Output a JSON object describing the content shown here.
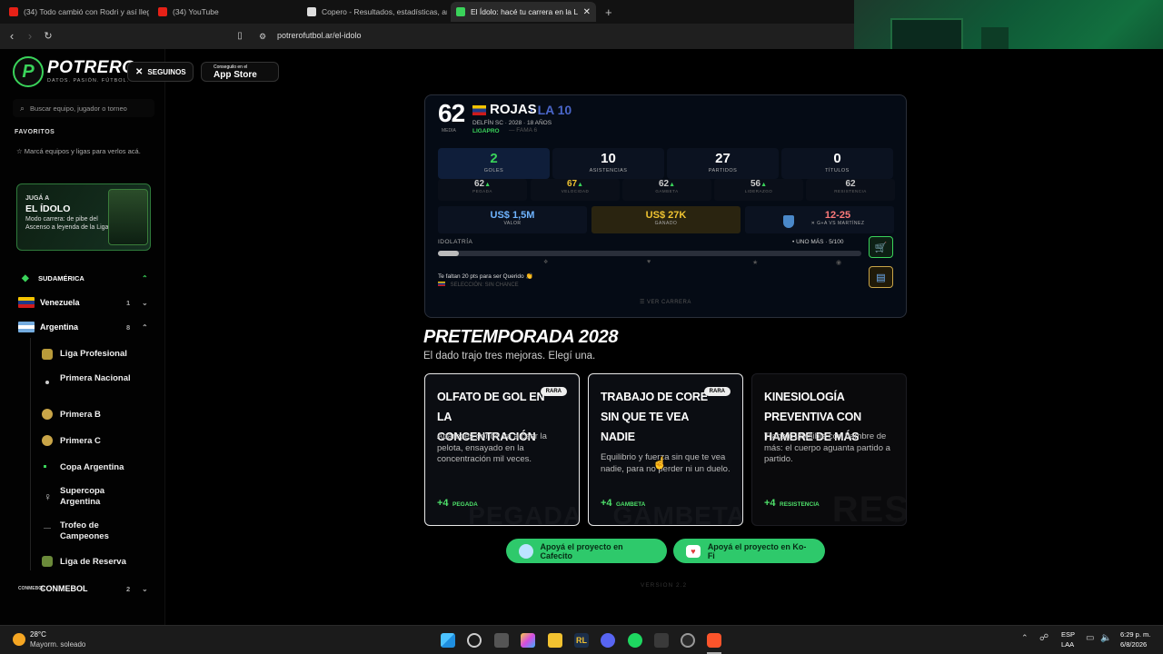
{
  "browser": {
    "tabs": [
      {
        "title": "(34) Todo cambió con Rodri y así lleg",
        "color": "#e62117"
      },
      {
        "title": "(34) YouTube",
        "color": "#e62117"
      },
      {
        "title": "Copero - Resultados, estadísticas, an",
        "color": "#dddddd"
      },
      {
        "title": "El Ídolo: hacé tu carrera en la Lig",
        "color": "#3ad35a"
      }
    ],
    "new_tab": "+",
    "url": "potrerofutbol.ar/el-idolo"
  },
  "sidebar": {
    "logo_text": "POTRERO",
    "logo_sub": "DATOS. PASIÓN. FÚTBOL.",
    "follow_label": "SEGUINOS",
    "appstore_small": "Conseguilo en el",
    "appstore_big": "App Store",
    "search_placeholder": "Buscar equipo, jugador o torneo",
    "favorites_title": "FAVORITOS",
    "favorites_note": "☆  Marcá equipos y ligas para verlos acá.",
    "idolo_promo": {
      "line1": "JUGÁ A",
      "line2": "EL ÍDOLO",
      "line3": "Modo carrera: de pibe del Ascenso a leyenda de la Liga"
    },
    "region": "SUDAMÉRICA",
    "countries": [
      {
        "name": "Venezuela",
        "count": "1"
      },
      {
        "name": "Argentina",
        "count": "8"
      }
    ],
    "leagues": [
      "Liga Profesional",
      "Primera Nacional",
      "Primera B",
      "Primera C",
      "Copa Argentina",
      "Supercopa Argentina",
      "Trofeo de Campeones",
      "Liga de Reserva"
    ],
    "conmebol": {
      "name": "CONMEBOL",
      "count": "2"
    }
  },
  "player": {
    "rating": "62",
    "rating_label": "MEDIA",
    "name": "ROJAS",
    "position": "LA 10",
    "club_line": "DELFÍN SC · 2028 · 18 AÑOS",
    "league": "LIGAPRO",
    "fame": "—   FAMA 6",
    "stats": [
      {
        "value": "2",
        "label": "GOLES"
      },
      {
        "value": "10",
        "label": "ASISTENCIAS"
      },
      {
        "value": "27",
        "label": "PARTIDOS"
      },
      {
        "value": "0",
        "label": "TÍTULOS"
      }
    ],
    "attributes": [
      {
        "value": "62",
        "up": "▲",
        "label": "PEGADA"
      },
      {
        "value": "67",
        "up": "▲",
        "label": "VELOCIDAD"
      },
      {
        "value": "62",
        "up": "▲",
        "label": "GAMBETA"
      },
      {
        "value": "56",
        "up": "▲",
        "label": "LIDERAZGO"
      },
      {
        "value": "62",
        "up": "",
        "label": "RESISTENCIA"
      }
    ],
    "value": {
      "amount": "US$ 1,5M",
      "label": "VALOR"
    },
    "earned": {
      "amount": "US$ 27K",
      "label": "GANADO"
    },
    "next_match": {
      "score": "12-25",
      "label": "✕ G+A VS MARTÍNEZ"
    },
    "idolatria_label": "IDOLATRÍA",
    "idolatria_status": "•  UNO MÁS · 5/100",
    "idolatria_progress": 0.05,
    "goal_note": "Te faltan 20 pts para ser Querido 👏",
    "selection_note": "SELECCIÓN: SIN CHANCE",
    "career_link": "☰  VER CARRERA"
  },
  "preseason": {
    "title": "PRETEMPORADA 2028",
    "subtitle": "El dado trajo tres mejoras. Elegí una.",
    "options": [
      {
        "title": "OLFATO DE GOL EN LA CONCENTRACIÓN",
        "badge": "RARA",
        "desc": "Aparecés donde va a caer la pelota, ensayado en la concentración mil veces.",
        "bonus": "+4",
        "stat": "PEGADA",
        "ghost": "PEGADA"
      },
      {
        "title": "TRABAJO DE CORE SIN QUE TE VEA NADIE",
        "badge": "RARA",
        "desc": "Equilibrio y fuerza sin que te vea nadie, para no perder ni un duelo.",
        "bonus": "+4",
        "stat": "GAMBETA",
        "ghost": "GAMBETA"
      },
      {
        "title": "KINESIOLOGÍA PREVENTIVA CON HAMBRE DE MÁS",
        "badge": "",
        "desc": "Trabajo invisible con hambre de más: el cuerpo aguanta partido a partido.",
        "bonus": "+4",
        "stat": "RESISTENCIA",
        "ghost": "RES"
      }
    ]
  },
  "support": {
    "cafecito": "Apoyá el proyecto en Cafecito",
    "kofi": "Apoyá el proyecto en Ko-Fi"
  },
  "version": "VERSION 2.2",
  "taskbar": {
    "weather_temp": "28°C",
    "weather_desc": "Mayorm. soleado",
    "lang1": "ESP",
    "lang2": "LAA",
    "time": "6:29 p. m.",
    "date": "6/8/2026"
  },
  "colors": {
    "accent": "#3ad35a",
    "card_bg": "#050b15",
    "gold": "#f0c431",
    "fame_blue": "#4a66c9"
  }
}
